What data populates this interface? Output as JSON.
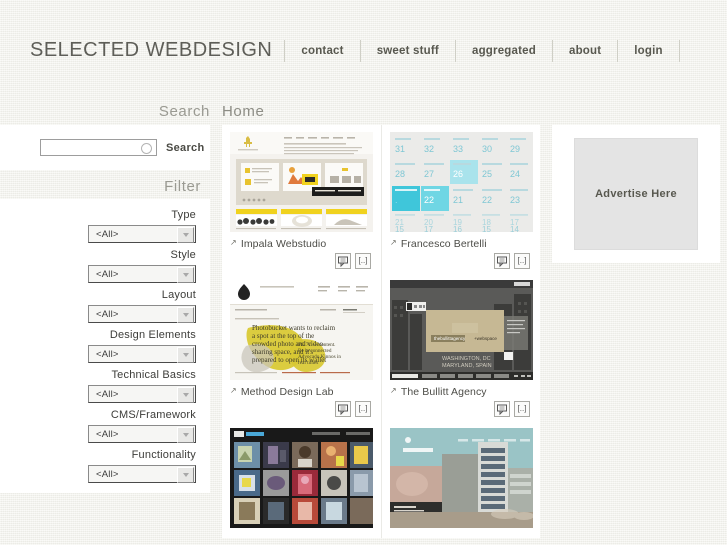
{
  "site": {
    "brand": "SELECTED WEBDESIGN",
    "nav": [
      {
        "label": "contact",
        "name": "nav-contact"
      },
      {
        "label": "sweet stuff",
        "name": "nav-sweet-stuff"
      },
      {
        "label": "aggregated",
        "name": "nav-aggregated"
      },
      {
        "label": "about",
        "name": "nav-about"
      },
      {
        "label": "login",
        "name": "nav-login"
      }
    ]
  },
  "headings": {
    "search": "Search",
    "home": "Home"
  },
  "search": {
    "value": "",
    "placeholder": "",
    "button_label": "Search",
    "icon": "magnifier-circle-icon"
  },
  "filter": {
    "heading": "Filter",
    "groups": [
      {
        "label": "Type",
        "value": "<All>",
        "name": "filter-select-type"
      },
      {
        "label": "Style",
        "value": "<All>",
        "name": "filter-select-style"
      },
      {
        "label": "Layout",
        "value": "<All>",
        "name": "filter-select-layout"
      },
      {
        "label": "Design Elements",
        "value": "<All>",
        "name": "filter-select-design-elements"
      },
      {
        "label": "Technical Basics",
        "value": "<All>",
        "name": "filter-select-technical-basics"
      },
      {
        "label": "CMS/Framework",
        "value": "<All>",
        "name": "filter-select-cms-framework"
      },
      {
        "label": "Functionality",
        "value": "<All>",
        "name": "filter-select-functionality"
      }
    ]
  },
  "gallery": {
    "arrow_glyph": "↗",
    "action_icons": {
      "comment": "comment-icon",
      "details": "details-icon",
      "details_glyph": "[..]"
    },
    "rows": [
      [
        {
          "title": "Impala Webstudio",
          "thumb": "impala"
        },
        {
          "title": "Francesco Bertelli",
          "thumb": "bertelli"
        }
      ],
      [
        {
          "title": "Method Design Lab",
          "thumb": "method"
        },
        {
          "title": "The Bullitt Agency",
          "thumb": "bullitt"
        }
      ],
      [
        {
          "title": "",
          "thumb": "gallery-dark"
        },
        {
          "title": "",
          "thumb": "building"
        }
      ]
    ]
  },
  "advertise": {
    "label": "Advertise Here"
  },
  "colors": {
    "page_background": "#f2f2ec",
    "panel": "#ffffff",
    "heading_text": "#9a9a92",
    "nav_text": "#58584f",
    "accent_cyan": "#3fc6da",
    "accent_cyan_light": "#a9e3ec",
    "accent_yellow": "#d8c832"
  }
}
